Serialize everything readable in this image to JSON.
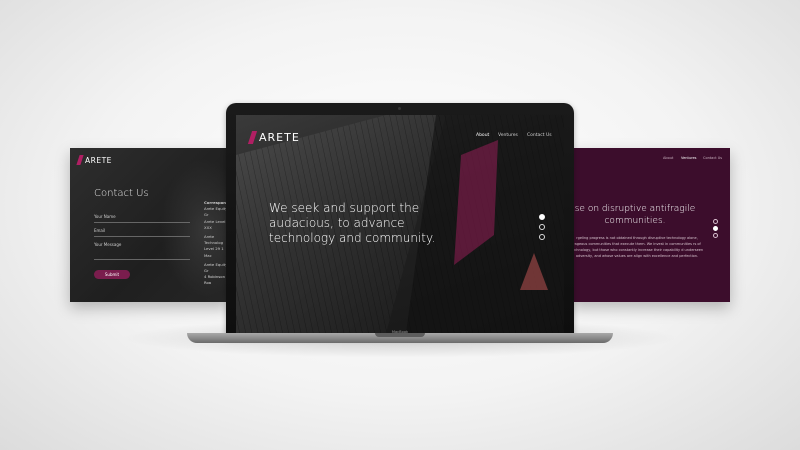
{
  "left_panel": {
    "logo": "ARETE",
    "title": "Contact Us",
    "fields": [
      "Your Name",
      "Email",
      "Your Message"
    ],
    "submit": "Submit",
    "correspondence": {
      "heading": "Correspond",
      "lines": [
        "Arete Equity Gr",
        "Arete Level XXX",
        "Arete Technolog",
        "Level 29 1 Mac",
        "Arete Equity Gr",
        "4 Robinson Roa"
      ]
    }
  },
  "laptop": {
    "logo": "ARETE",
    "nav": [
      "About",
      "Ventures",
      "Contact Us"
    ],
    "active_nav": "About",
    "headline": "We seek and support the audacious, to advance technology and community.",
    "slide_count": 3,
    "active_slide": 0,
    "brand": "MacBook",
    "accent": "#b01f63"
  },
  "right_panel": {
    "nav": [
      "About",
      "Ventures",
      "Contact Us"
    ],
    "active_nav": "Ventures",
    "headline": "se on disruptive antifragile communities.",
    "body": "rgeling progress is not obtained through disruptive technology alone, rageous communities that execute them. We invest in communities rs of technology, but those who constantly increase their capability d underseen adversity, and whose values are align with excellence and perfection.",
    "slide_count": 3,
    "active_slide": 1,
    "background": "#3c0d2c"
  }
}
